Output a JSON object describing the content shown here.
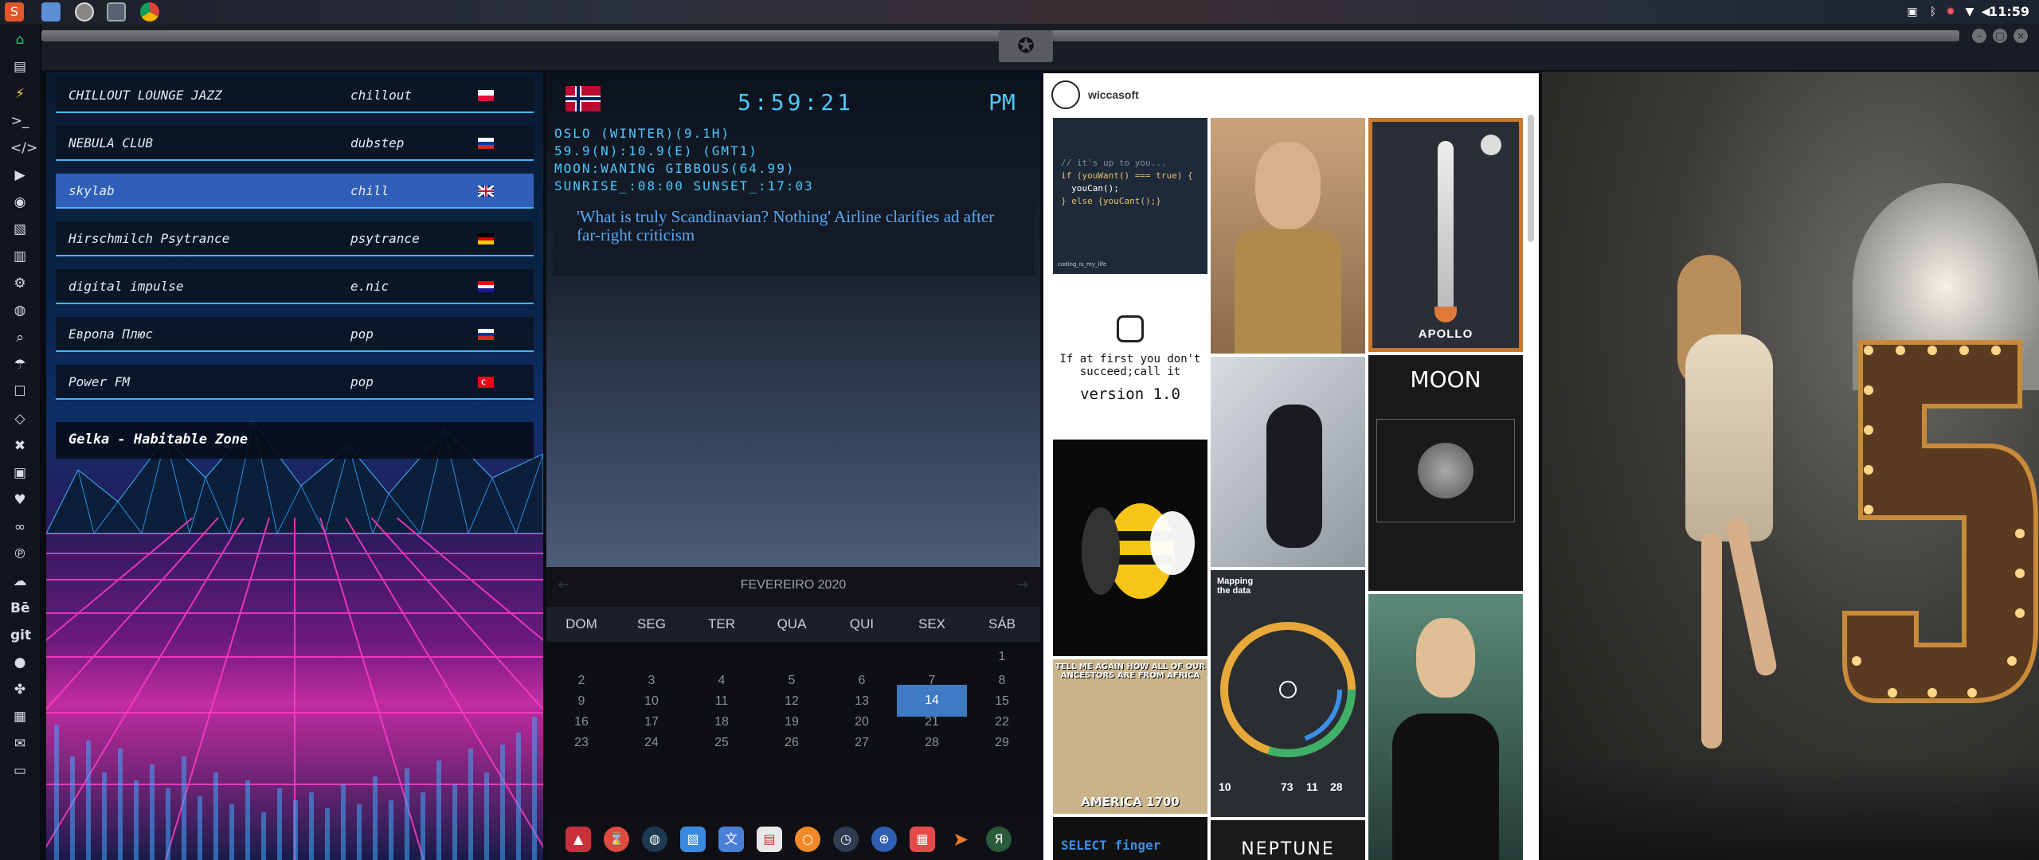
{
  "topbar": {
    "clock": "11:59",
    "app_icons": [
      "sublime-icon",
      "files-icon",
      "system-monitor-icon",
      "terminal-icon",
      "chrome-icon"
    ],
    "tray_icons": [
      "image-icon",
      "bluetooth-icon",
      "notification-icon",
      "wifi-icon",
      "volume-icon"
    ]
  },
  "sidebar": {
    "icons": [
      "home-icon",
      "document-icon",
      "bolt-icon",
      "terminal-icon",
      "code-icon",
      "play-icon",
      "chat-icon",
      "image-icon",
      "book-icon",
      "settings-icon",
      "globe-icon",
      "search-icon",
      "umbrella-icon",
      "contact-icon",
      "tag-icon",
      "tools-icon",
      "video-icon",
      "heart-icon",
      "link-icon",
      "pinterest-icon",
      "cloud-icon",
      "behance-icon",
      "git-icon",
      "github-icon",
      "network-icon",
      "map-icon",
      "mail-icon",
      "window-icon"
    ],
    "text_labels": {
      "behance": "Bē",
      "git": "git"
    }
  },
  "radio": {
    "stations": [
      {
        "name": "CHILLOUT LOUNGE JAZZ",
        "genre": "chillout",
        "flag": "poland"
      },
      {
        "name": "NEBULA CLUB",
        "genre": "dubstep",
        "flag": "russia"
      },
      {
        "name": "skylab",
        "genre": "chill",
        "flag": "uk",
        "active": true
      },
      {
        "name": "Hirschmilch Psytrance",
        "genre": "psytrance",
        "flag": "germany"
      },
      {
        "name": "digital impulse",
        "genre": "e.nic",
        "flag": "croatia"
      },
      {
        "name": "Европа Плюс",
        "genre": "pop",
        "flag": "russia"
      },
      {
        "name": "Power FM",
        "genre": "pop",
        "flag": "turkey"
      }
    ],
    "now_playing": "Gelka - Habitable Zone"
  },
  "clock_panel": {
    "time": "5:59:21",
    "ampm": "PM",
    "lines": [
      "OSLO (WINTER)(9.1H)",
      "59.9(N):10.9(E) (GMT1)",
      "MOON:WANING GIBBOUS(64.99)",
      "SUNRISE_:08:00 SUNSET_:17:03"
    ],
    "news": "'What is truly Scandinavian? Nothing' Airline clarifies ad after far-right criticism"
  },
  "calendar": {
    "month": "FEVEREIRO 2020",
    "weekdays": [
      "DOM",
      "SEG",
      "TER",
      "QUA",
      "QUI",
      "SEX",
      "SÁB"
    ],
    "rows": [
      [
        "",
        "",
        "",
        "",
        "",
        "",
        "1"
      ],
      [
        "2",
        "3",
        "4",
        "5",
        "6",
        "7",
        "8"
      ],
      [
        "9",
        "10",
        "11",
        "12",
        "13",
        "14",
        "15"
      ],
      [
        "16",
        "17",
        "18",
        "19",
        "20",
        "21",
        "22"
      ],
      [
        "23",
        "24",
        "25",
        "26",
        "27",
        "28",
        "29"
      ]
    ],
    "today": "14"
  },
  "dock": {
    "icons": [
      "app-launcher-icon",
      "timer-icon",
      "globe-dark-icon",
      "image-viewer-icon",
      "translate-icon",
      "news-icon",
      "search-orange-icon",
      "clock-icon",
      "web-icon",
      "calendar-icon",
      "arrow-icon",
      "yandex-icon"
    ]
  },
  "pinterest": {
    "username": "wiccasoft",
    "code_tile": {
      "lines": [
        "// it's up to you...",
        "if (youWant() === true) {",
        "  youCan();",
        "} else {youCant();}"
      ],
      "caption": "coding_is_my_life"
    },
    "version_tile": "If at first you don't succeed;call it",
    "version_text": "version 1.0",
    "apollo_label": "APOLLO",
    "moon_label": "MOON",
    "mapping_label": "Mapping the data",
    "ancestors_label": "TELL ME AGAIN HOW ALL OF OUR ANCESTORS ARE FROM AFRICA",
    "america_label": "AMERICA 1700",
    "mapping_numbers": [
      "10",
      "73",
      "11",
      "28"
    ],
    "neptune_label": "NEPTUNE",
    "select_label": "SELECT finger"
  },
  "colors": {
    "accent_blue": "#4cc8ff",
    "station_active": "#2f5fb8",
    "calendar_today": "#3e7bc4",
    "news_link": "#5aa9f2"
  }
}
